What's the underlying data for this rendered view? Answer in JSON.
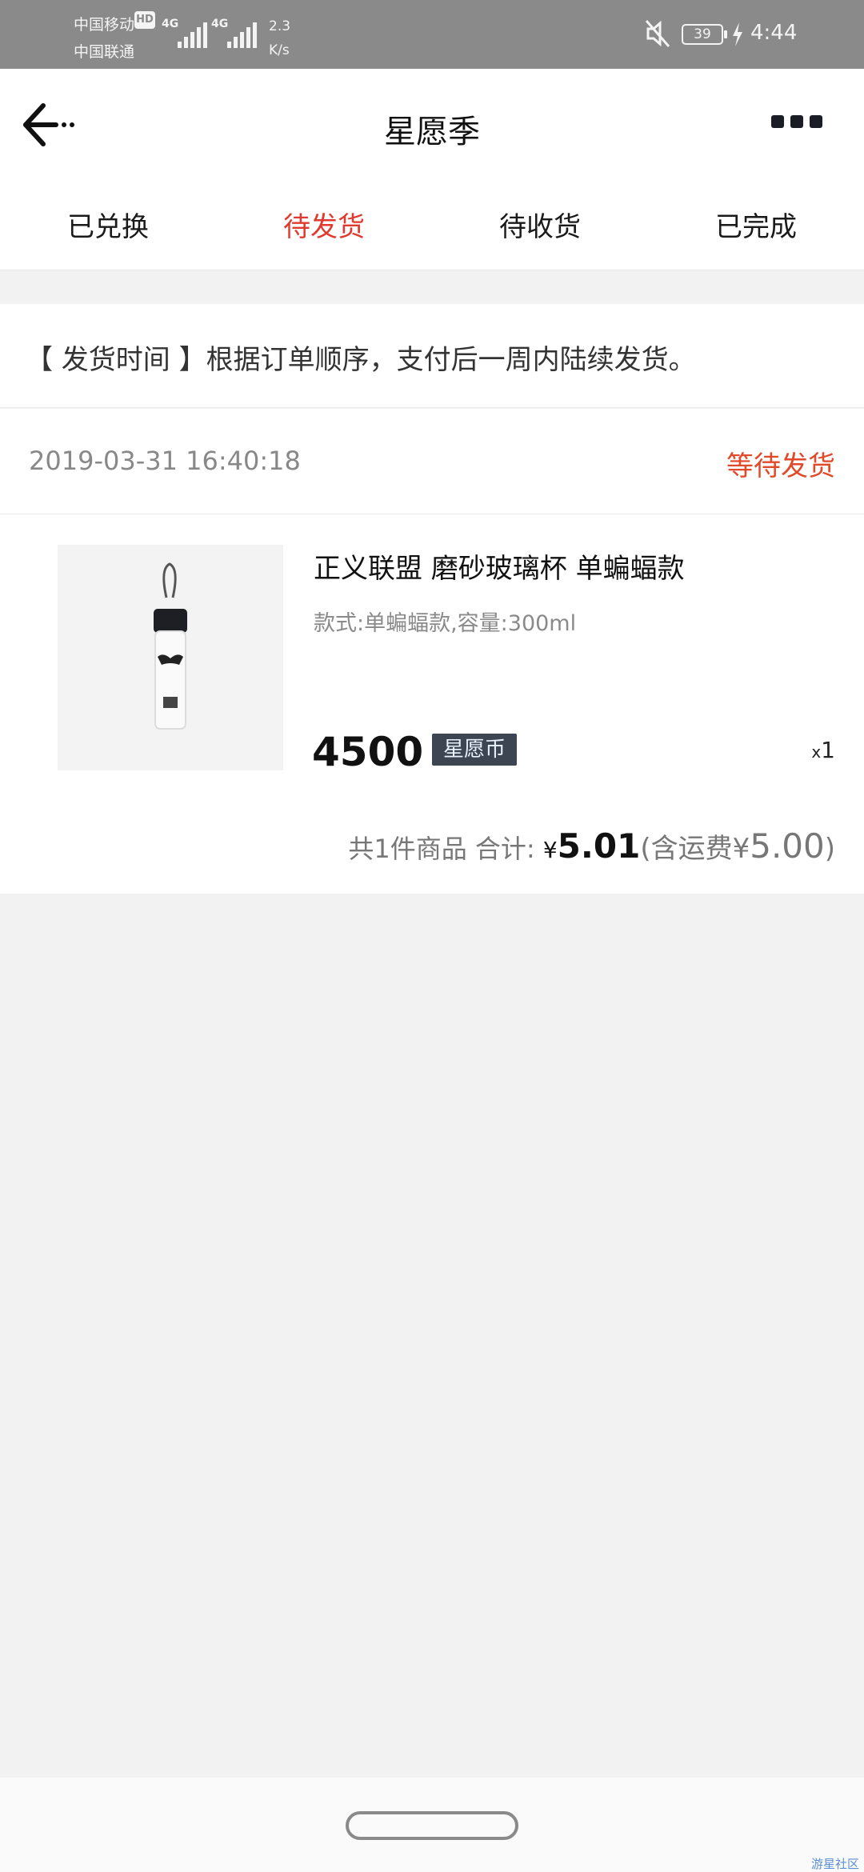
{
  "status_bar": {
    "carrier1": "中国移动",
    "hd": "HD",
    "carrier2": "中国联通",
    "signal1_label": "4G",
    "signal2_label": "4G",
    "speed_value": "2.3",
    "speed_unit": "K/s",
    "battery": "39",
    "time": "4:44"
  },
  "header": {
    "title": "星愿季",
    "back_icon": "arrow-left-icon",
    "more_icon": "more-dots-icon"
  },
  "tabs": [
    {
      "label": "已兑换",
      "active": false
    },
    {
      "label": "待发货",
      "active": true
    },
    {
      "label": "待收货",
      "active": false
    },
    {
      "label": "已完成",
      "active": false
    }
  ],
  "notice": "【 发货时间 】根据订单顺序，支付后一周内陆续发货。",
  "order": {
    "time": "2019-03-31 16:40:18",
    "status": "等待发货",
    "status_color": "#e0492a",
    "product": {
      "name": "正义联盟 磨砂玻璃杯 单蝙蝠款",
      "spec": "款式:单蝙蝠款,容量:300ml",
      "price": "4500",
      "currency_badge": "星愿币",
      "qty_prefix": "x",
      "qty": "1"
    },
    "summary": {
      "count_text": "共1件商品 合计:",
      "currency": "¥",
      "total": "5.01",
      "shipping_prefix": "(含运费¥",
      "shipping": "5.00",
      "shipping_suffix": ")"
    }
  },
  "watermark": "游星社区",
  "colors": {
    "accent": "#e03a2f",
    "badge_bg": "#3d4552",
    "status_bar_bg": "#8a8a8a"
  }
}
